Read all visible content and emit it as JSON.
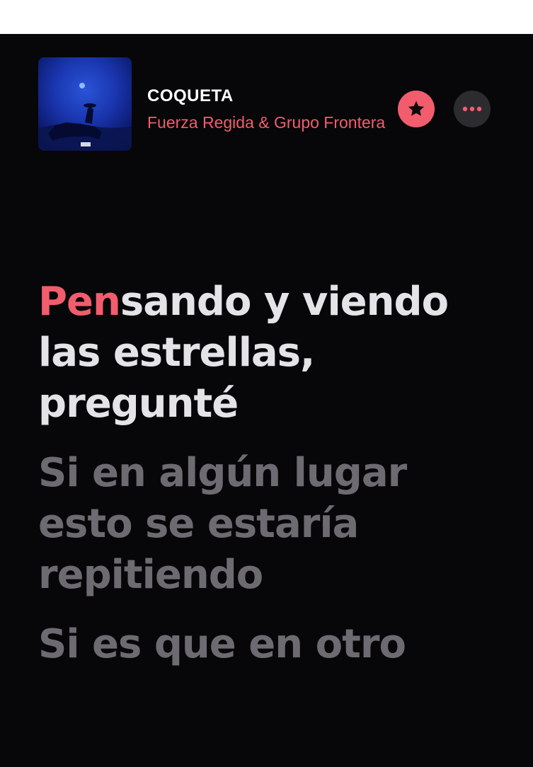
{
  "now_playing": {
    "title": "COQUETA",
    "artist": "Fuerza Regida & Grupo Frontera"
  },
  "icons": {
    "favorite": "star-icon",
    "more": "ellipsis-icon"
  },
  "colors": {
    "accent": "#f25d6d",
    "background": "#070608",
    "active_lyric": "#e4e3e8",
    "inactive_lyric": "#6d6b71"
  },
  "lyrics": {
    "current": {
      "sung": "Pen",
      "unsung": "sando y viendo las estrellas, pregunté"
    },
    "lines": [
      "Si en algún lugar esto se estaría repitiendo",
      "Si es que en otro"
    ]
  }
}
